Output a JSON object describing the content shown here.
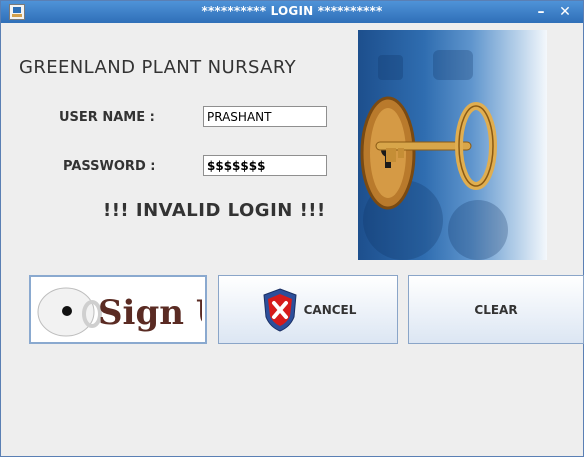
{
  "window": {
    "title": "********** LOGIN **********",
    "icons": [
      "app-icon",
      "minimize-icon",
      "close-icon"
    ]
  },
  "brand": "GREENLAND PLANT NURSARY",
  "form": {
    "username_label": "USER NAME :",
    "username_value": "PRASHANT",
    "password_label": "PASSWORD :",
    "password_value": "$$$$$$$",
    "error_message": "!!! INVALID LOGIN !!!"
  },
  "buttons": {
    "signup_label": "Sign Up",
    "cancel_label": "CANCEL",
    "clear_label": "CLEAR"
  },
  "colors": {
    "titlebar": "#3b82cc",
    "signup_text": "#5a2b23",
    "cancel_icon_red": "#d61b1b"
  }
}
